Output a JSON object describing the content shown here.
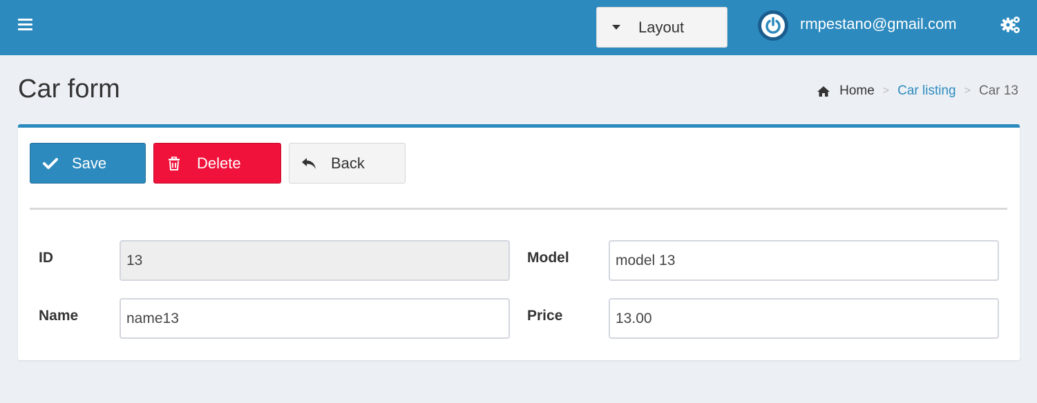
{
  "topbar": {
    "layout_label": "Layout",
    "user_email": "rmpestano@gmail.com",
    "accent_color": "#2c8abe"
  },
  "header": {
    "title": "Car form",
    "breadcrumb": {
      "home": "Home",
      "separator": ">",
      "link": "Car listing",
      "current": "Car 13"
    }
  },
  "toolbar": {
    "save_label": "Save",
    "delete_label": "Delete",
    "back_label": "Back"
  },
  "form": {
    "id_label": "ID",
    "id_value": "13",
    "model_label": "Model",
    "model_value": "model 13",
    "name_label": "Name",
    "name_value": "name13",
    "price_label": "Price",
    "price_value": "13.00"
  },
  "icons": {
    "menu": "hamburger-icon",
    "layout": "caret-down-icon",
    "avatar": "power-icon",
    "settings": "gears-icon",
    "home": "home-icon",
    "save": "check-icon",
    "delete": "trash-icon",
    "back": "reply-icon"
  },
  "colors": {
    "primary": "#2c8abe",
    "danger": "#f0123a",
    "default": "#f4f4f4",
    "background": "#ecf0f5"
  }
}
